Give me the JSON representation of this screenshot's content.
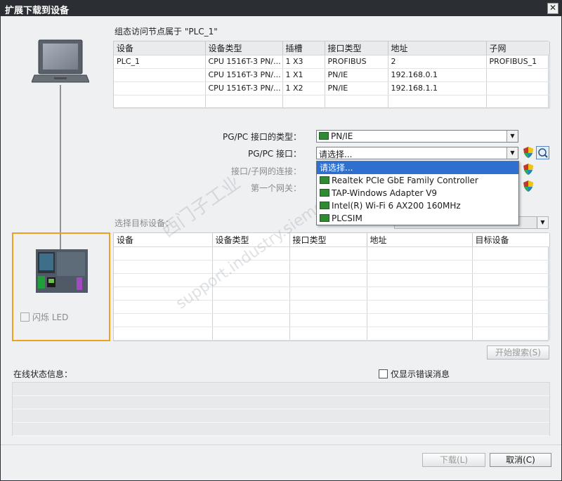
{
  "window": {
    "title": "扩展下载到设备",
    "close_label": "✕"
  },
  "config": {
    "heading": "组态访问节点属于 \"PLC_1\"",
    "columns": [
      "设备",
      "设备类型",
      "插槽",
      "接口类型",
      "地址",
      "子网"
    ],
    "rows": [
      [
        "PLC_1",
        "CPU 1516T-3 PN/...",
        "1 X3",
        "PROFIBUS",
        "2",
        "PROFIBUS_1"
      ],
      [
        "",
        "CPU 1516T-3 PN/...",
        "1 X1",
        "PN/IE",
        "192.168.0.1",
        ""
      ],
      [
        "",
        "CPU 1516T-3 PN/...",
        "1 X2",
        "PN/IE",
        "192.168.1.1",
        ""
      ],
      [
        "",
        "",
        "",
        "",
        "",
        ""
      ]
    ]
  },
  "interface": {
    "type_label": "PG/PC 接口的类型：",
    "type_value": "PN/IE",
    "pgpc_label": "PG/PC 接口：",
    "pgpc_value": "请选择...",
    "subnet_label": "接口/子网的连接：",
    "gateway_label": "第一个网关：",
    "dropdown_options": [
      "请选择...",
      "Realtek PCIe GbE Family Controller",
      "TAP-Windows Adapter V9",
      "Intel(R) Wi-Fi 6 AX200 160MHz",
      "PLCSIM"
    ]
  },
  "target": {
    "heading": "选择目标设备：",
    "columns": [
      "设备",
      "设备类型",
      "接口类型",
      "地址",
      "目标设备"
    ],
    "empty_rows": 7,
    "flash_led_label": "闪烁 LED",
    "search_button": "开始搜索(S)"
  },
  "status": {
    "heading": "在线状态信息：",
    "only_errors_label": "仅显示错误消息"
  },
  "buttons": {
    "load": "下载(L)",
    "cancel": "取消(C)"
  },
  "watermark": {
    "line1": "西门子工业",
    "line2": "support.industry.siemens"
  },
  "colors": {
    "titlebar": "#2b2f34",
    "highlight_border": "#f0a020",
    "selection": "#2f6fd0",
    "nic_green": "#2f8a32"
  }
}
